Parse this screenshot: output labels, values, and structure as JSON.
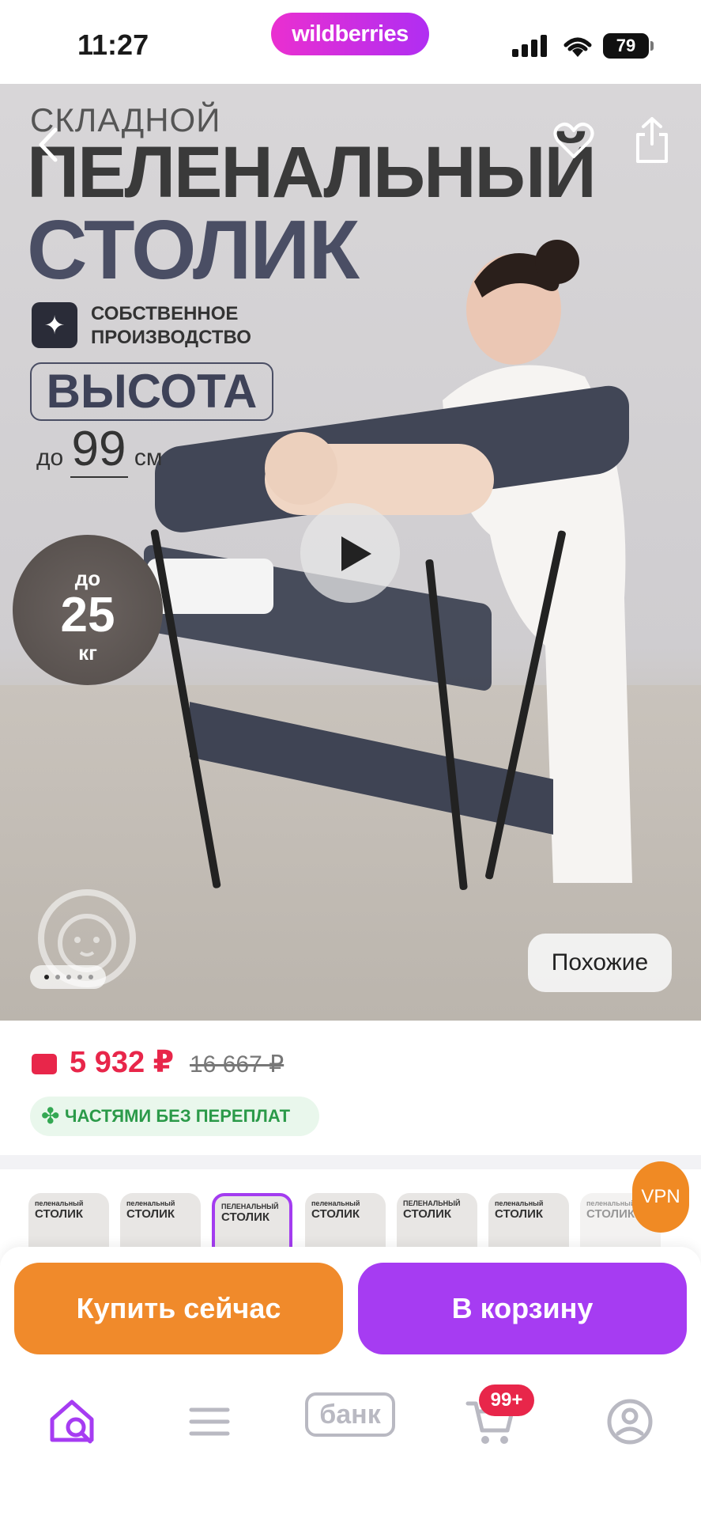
{
  "status_bar": {
    "time": "11:27",
    "brand": "wildberries",
    "battery": "79"
  },
  "hero": {
    "headline_small": "СКЛАДНОЙ",
    "headline_line1": "ПЕЛЕНАЛЬНЫЙ",
    "headline_line2": "СТОЛИК",
    "own_production": "СОБСТВЕННОЕ ПРОИЗВОДСТВО",
    "height_label": "ВЫСОТА",
    "height_prefix": "до",
    "height_value": "99",
    "height_unit": "см",
    "weight_prefix": "до",
    "weight_value": "25",
    "weight_unit": "кг",
    "similar_label": "Похожие",
    "slide_count": 5,
    "active_slide": 1
  },
  "price": {
    "current": "5 932 ₽",
    "old": "16 667 ₽",
    "installment": "ЧАСТЯМИ БЕЗ ПЕРЕПЛАТ"
  },
  "thumbnails": [
    {
      "line1": "пеленальный",
      "line2": "СТОЛИК",
      "selected": false
    },
    {
      "line1": "пеленальный",
      "line2": "СТОЛИК",
      "selected": false
    },
    {
      "line1": "ПЕЛЕНАЛЬНЫЙ",
      "line2": "СТОЛИК",
      "selected": true
    },
    {
      "line1": "пеленальный",
      "line2": "СТОЛИК",
      "selected": false
    },
    {
      "line1": "ПЕЛЕНАЛЬНЫЙ",
      "line2": "СТОЛИК",
      "selected": false
    },
    {
      "line1": "пеленальный",
      "line2": "СТОЛИК",
      "selected": false
    },
    {
      "line1": "пеленальный",
      "line2": "СТОЛИК",
      "selected": false
    }
  ],
  "vpn_label": "VPN",
  "actions": {
    "buy_now": "Купить сейчас",
    "add_to_cart": "В корзину"
  },
  "tabbar": {
    "bank_label": "банк",
    "cart_badge": "99+"
  },
  "colors": {
    "brand_gradient_start": "#ea2fd0",
    "brand_gradient_end": "#b02ef2",
    "price_red": "#e8264a",
    "buy_orange": "#f08a2b",
    "cart_purple": "#a63cf2",
    "installment_green": "#2b9a49"
  }
}
